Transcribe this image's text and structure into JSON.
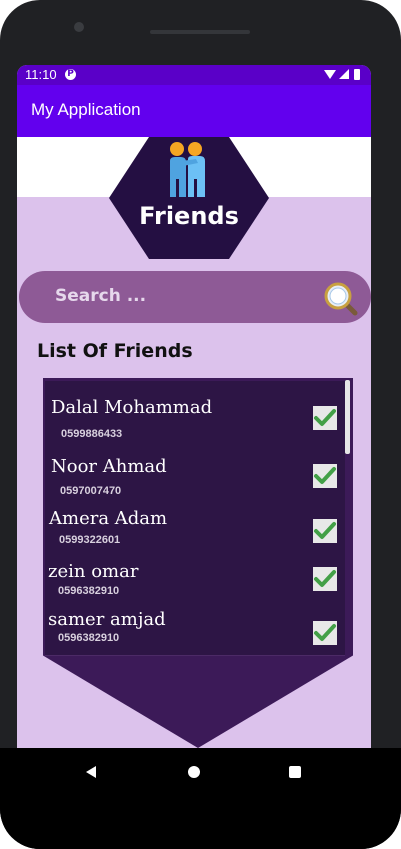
{
  "status_bar": {
    "time": "11:10"
  },
  "app_bar": {
    "title": "My Application"
  },
  "header": {
    "title": "Friends",
    "icon": "friends-icon"
  },
  "search": {
    "placeholder": "Search ...",
    "icon": "magnifier-icon"
  },
  "list": {
    "title": "List Of Friends",
    "items": [
      {
        "name": "Dalal Mohammad",
        "phone": "0599886433",
        "checked": true
      },
      {
        "name": "Noor Ahmad",
        "phone": "0597007470",
        "checked": true
      },
      {
        "name": "Amera Adam",
        "phone": "0599322601",
        "checked": true
      },
      {
        "name": "zein omar",
        "phone": "0596382910",
        "checked": true
      },
      {
        "name": "samer amjad",
        "phone": "0596382910",
        "checked": true
      }
    ]
  },
  "colors": {
    "appbar": "#6200ee",
    "statusbar": "#5a00c8",
    "accent_dark": "#240f42",
    "search": "#8e5a96",
    "page": "#dcc2ec",
    "check": "#43a047"
  }
}
